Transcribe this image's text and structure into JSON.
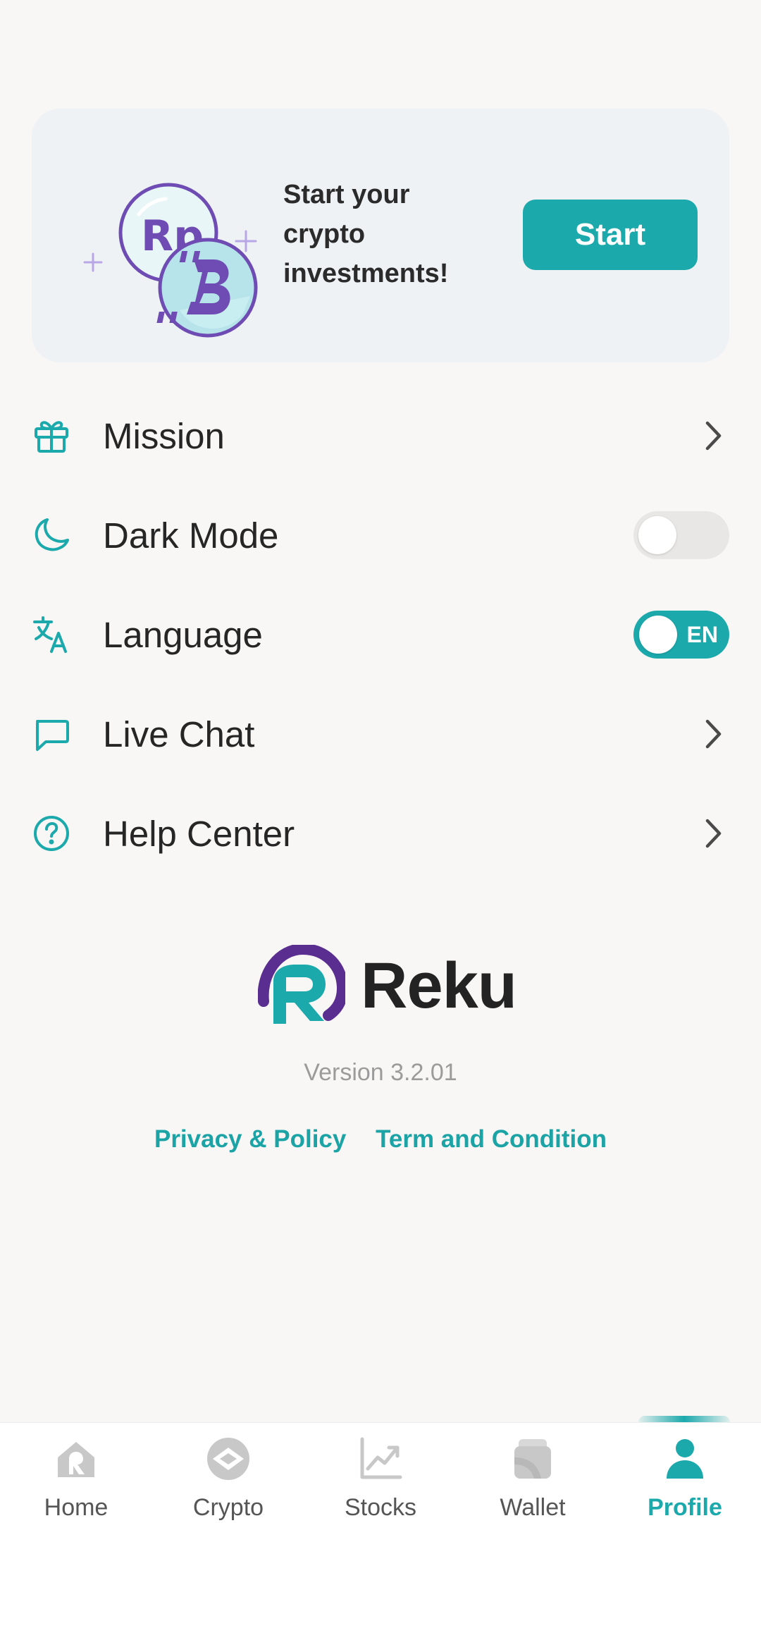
{
  "promo": {
    "title": "Start your crypto investments!",
    "button_label": "Start",
    "art_text": "Rp"
  },
  "menu": {
    "mission": {
      "label": "Mission",
      "icon": "gift-icon"
    },
    "dark_mode": {
      "label": "Dark Mode",
      "icon": "moon-icon",
      "enabled": false
    },
    "language": {
      "label": "Language",
      "icon": "translate-icon",
      "value": "EN"
    },
    "live_chat": {
      "label": "Live Chat",
      "icon": "chat-bubble-icon"
    },
    "help_center": {
      "label": "Help Center",
      "icon": "question-circle-icon"
    }
  },
  "brand": {
    "name": "Reku",
    "version": "Version 3.2.01"
  },
  "links": {
    "privacy": "Privacy & Policy",
    "terms": "Term and Condition"
  },
  "nav": {
    "items": [
      {
        "label": "Home",
        "icon": "home-icon"
      },
      {
        "label": "Crypto",
        "icon": "crypto-icon"
      },
      {
        "label": "Stocks",
        "icon": "stocks-chart-icon"
      },
      {
        "label": "Wallet",
        "icon": "wallet-icon"
      },
      {
        "label": "Profile",
        "icon": "profile-icon"
      }
    ],
    "active": "Profile"
  },
  "colors": {
    "accent": "#1ba9ac",
    "background": "#f8f7f5",
    "card": "#eff2f5",
    "illustration_purple": "#6e4cb3"
  }
}
